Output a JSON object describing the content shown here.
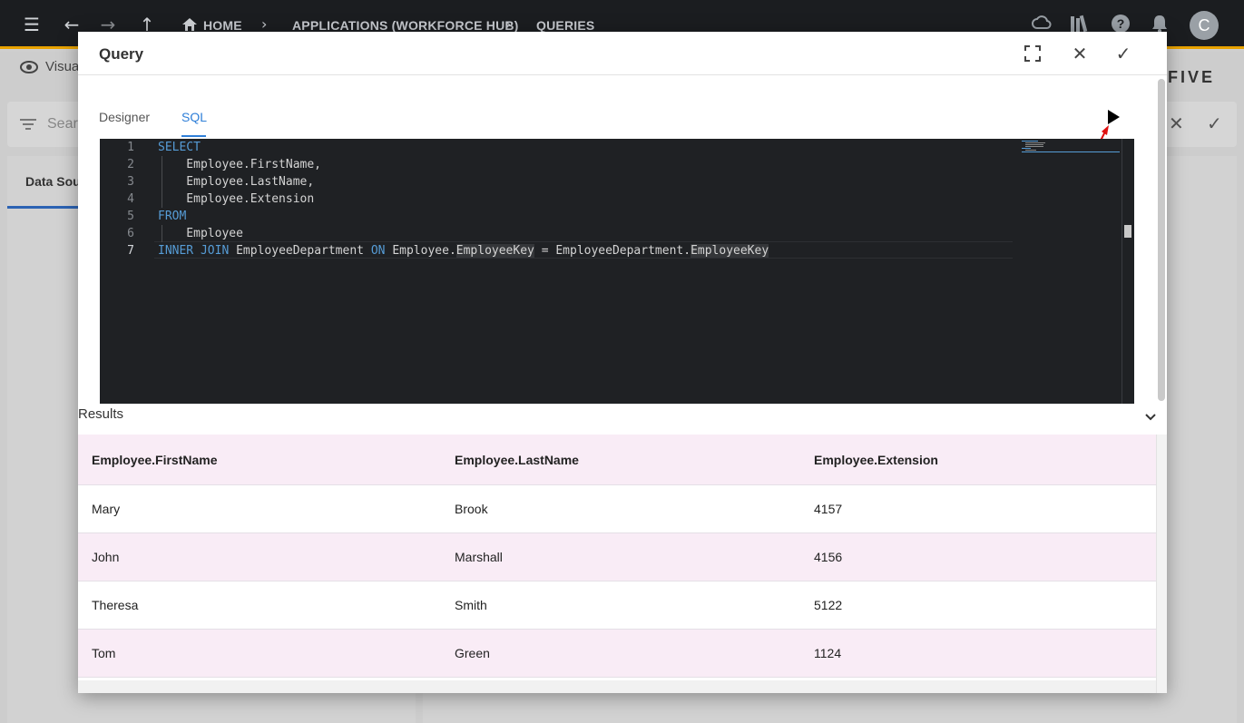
{
  "topbar": {
    "breadcrumbs": [
      "HOME",
      "APPLICATIONS (WORKFORCE HUB)",
      "QUERIES"
    ],
    "avatar_letter": "C",
    "icons": [
      "menu-icon",
      "back-arrow-icon",
      "forward-arrow-icon",
      "up-arrow-icon",
      "home-icon",
      "cloud-sync-icon",
      "library-icon",
      "help-icon",
      "bell-icon"
    ],
    "accent_color": "#e8a200"
  },
  "background": {
    "visual_label": "Visua",
    "search_placeholder": "Sear",
    "left_tab": "Data Sou",
    "brand": "FIVE"
  },
  "dialog": {
    "title": "Query",
    "tabs": [
      {
        "label": "Designer",
        "active": false
      },
      {
        "label": "SQL",
        "active": true
      }
    ],
    "accent_color": "#2f7fd8"
  },
  "editor": {
    "line_numbers": [
      "1",
      "2",
      "3",
      "4",
      "5",
      "6",
      "7"
    ],
    "current_line": 7,
    "lines": [
      "SELECT",
      "    Employee.FirstName,",
      "    Employee.LastName,",
      "    Employee.Extension",
      "FROM",
      "    Employee",
      "INNER JOIN EmployeeDepartment ON Employee.EmployeeKey = EmployeeDepartment.EmployeeKey"
    ],
    "keyword_color": "#569cd6"
  },
  "results": {
    "title": "Results",
    "columns": [
      "Employee.FirstName",
      "Employee.LastName",
      "Employee.Extension"
    ],
    "rows": [
      [
        "Mary",
        "Brook",
        "4157"
      ],
      [
        "John",
        "Marshall",
        "4156"
      ],
      [
        "Theresa",
        "Smith",
        "5122"
      ],
      [
        "Tom",
        "Green",
        "1124"
      ]
    ]
  }
}
